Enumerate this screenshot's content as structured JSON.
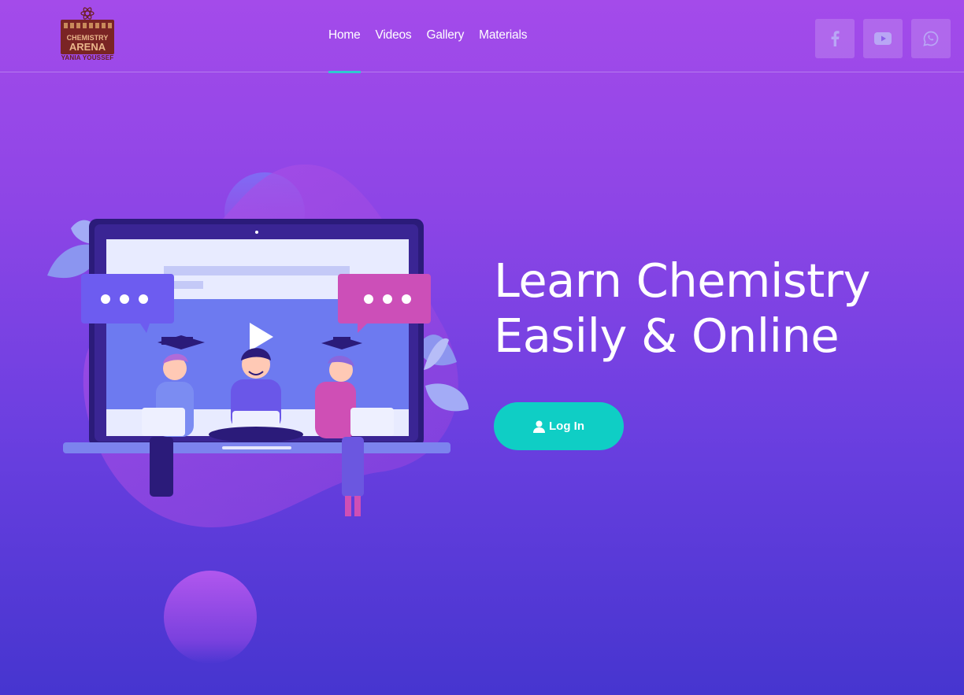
{
  "brand": {
    "logo_text": "YANIA YOUSSEF",
    "logo_lettering": "CHEMISTRY ARENA"
  },
  "nav": {
    "items": [
      {
        "label": "Home",
        "active": true
      },
      {
        "label": "Videos",
        "active": false
      },
      {
        "label": "Gallery",
        "active": false
      },
      {
        "label": "Materials",
        "active": false
      }
    ]
  },
  "social": [
    {
      "icon": "facebook-icon"
    },
    {
      "icon": "youtube-icon"
    },
    {
      "icon": "whatsapp-icon"
    }
  ],
  "hero": {
    "headline_line1": "Learn Chemistry",
    "headline_line2": "Easily & Online",
    "login_label": "Log In",
    "login_icon": "user-icon"
  },
  "colors": {
    "accent": "#0fcec5",
    "nav_underline": "#2ec9cf",
    "gradient_top": "#a44bea",
    "gradient_bottom": "#4635cf"
  }
}
